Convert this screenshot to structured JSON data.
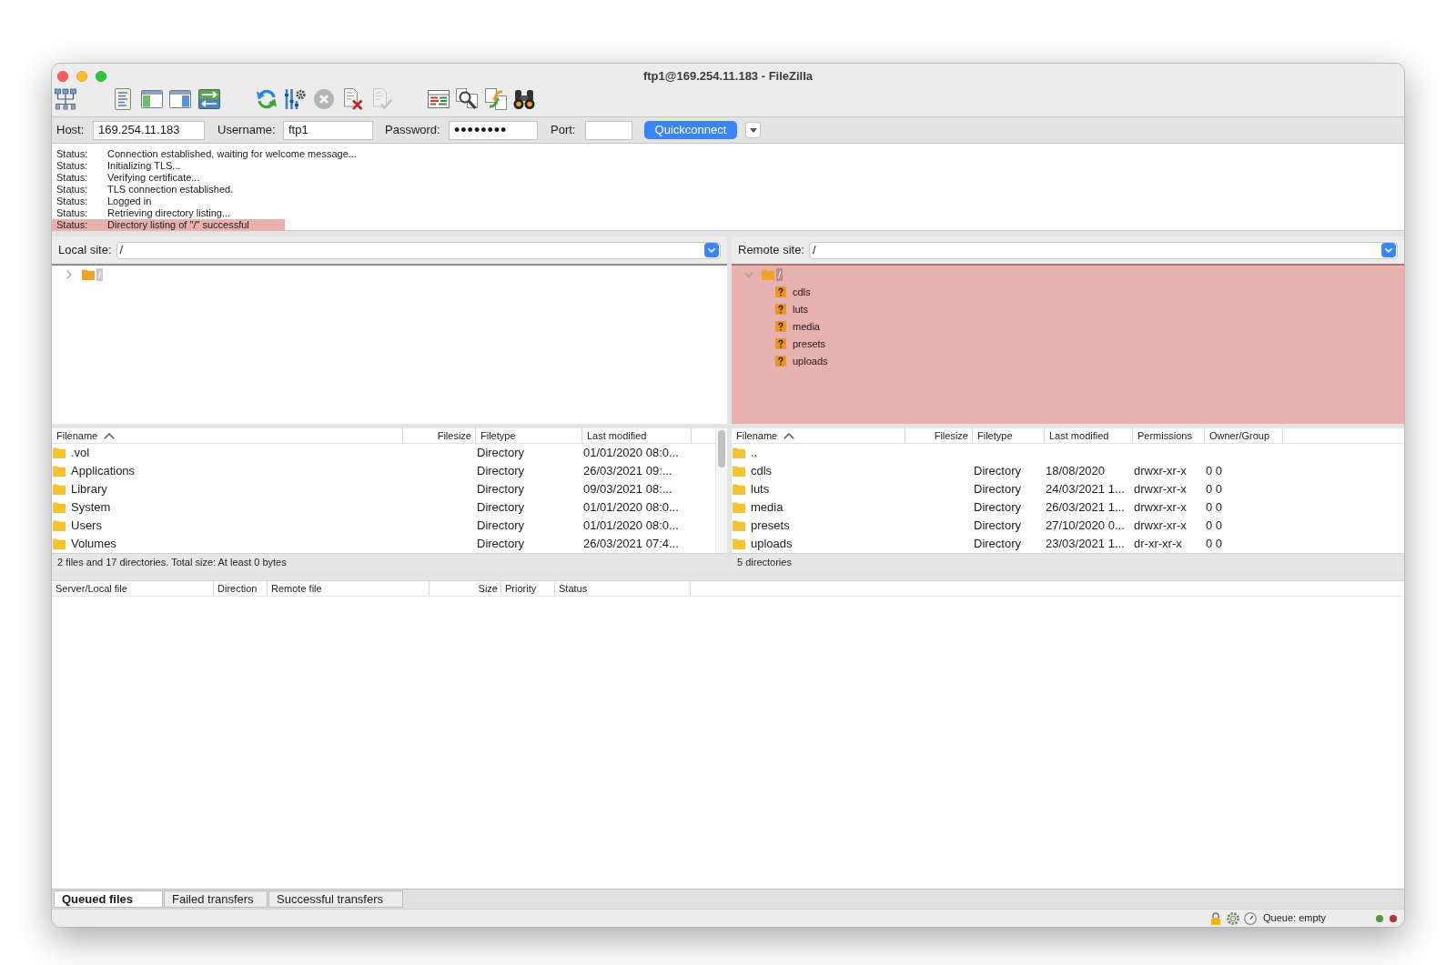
{
  "window": {
    "title": "ftp1@169.254.11.183 - FileZilla"
  },
  "toolbar": [
    [
      {
        "kind": "site-manager",
        "disabled": false
      }
    ],
    [
      {
        "kind": "message-log",
        "disabled": false
      },
      {
        "kind": "local-tree",
        "disabled": false
      },
      {
        "kind": "remote-tree",
        "disabled": false
      },
      {
        "kind": "transfer-queue",
        "disabled": false
      }
    ],
    [
      {
        "kind": "refresh",
        "disabled": false
      },
      {
        "kind": "process-queue",
        "disabled": false
      },
      {
        "kind": "cancel",
        "disabled": true
      },
      {
        "kind": "disconnect",
        "disabled": false
      },
      {
        "kind": "reconnect",
        "disabled": true
      }
    ],
    [
      {
        "kind": "filters",
        "disabled": false
      },
      {
        "kind": "compare",
        "disabled": false
      },
      {
        "kind": "sync-browsing",
        "disabled": false
      },
      {
        "kind": "search",
        "disabled": false
      }
    ]
  ],
  "quickconnect": {
    "fields": [
      {
        "kind": "text",
        "label": "Host:",
        "value": "169.254.11.183"
      },
      {
        "kind": "text",
        "label": "Username:",
        "value": "ftp1"
      },
      {
        "kind": "password",
        "label": "Password:",
        "value": "••••••••"
      },
      {
        "kind": "text",
        "label": "Port:"
      }
    ],
    "button": "Quickconnect"
  },
  "message_log": [
    {
      "type": "Status:",
      "text": "Connection established, waiting for welcome message...",
      "highlighted": false
    },
    {
      "type": "Status:",
      "text": "Initializing TLS...",
      "highlighted": false
    },
    {
      "type": "Status:",
      "text": "Verifying certificate...",
      "highlighted": false
    },
    {
      "type": "Status:",
      "text": "TLS connection established.",
      "highlighted": false
    },
    {
      "type": "Status:",
      "text": "Logged in",
      "highlighted": false
    },
    {
      "type": "Status:",
      "text": "Retrieving directory listing...",
      "highlighted": false
    },
    {
      "type": "Status:",
      "text": "Directory listing of \"/\" successful",
      "highlighted": true
    }
  ],
  "local_site": {
    "label": "Local site:",
    "path": "/",
    "highlighted": false,
    "tree": [
      {
        "name": "/",
        "expanded": false,
        "selected": true
      }
    ]
  },
  "remote_site": {
    "label": "Remote site:",
    "path": "/",
    "highlighted": true,
    "tree": [
      {
        "name": "/",
        "expanded": true,
        "selected": true,
        "children": [
          {
            "name": "cdls",
            "selected": false
          },
          {
            "name": "luts",
            "selected": false
          },
          {
            "name": "media",
            "selected": false
          },
          {
            "name": "presets",
            "selected": false
          },
          {
            "name": "uploads",
            "selected": false
          }
        ]
      }
    ]
  },
  "local_files": {
    "columns": [
      {
        "label": "Filename",
        "sorted": true
      },
      {
        "label": "Filesize",
        "sorted": false
      },
      {
        "label": "Filetype",
        "sorted": false
      },
      {
        "label": "Last modified",
        "sorted": false
      }
    ],
    "rows": [
      {
        "filename": ".vol",
        "filetype": "Directory",
        "last_modified": "01/01/2020 08:0..."
      },
      {
        "filename": "Applications",
        "filetype": "Directory",
        "last_modified": "26/03/2021 09:..."
      },
      {
        "filename": "Library",
        "filetype": "Directory",
        "last_modified": "09/03/2021 08:..."
      },
      {
        "filename": "System",
        "filetype": "Directory",
        "last_modified": "01/01/2020 08:0..."
      },
      {
        "filename": "Users",
        "filetype": "Directory",
        "last_modified": "01/01/2020 08:0..."
      },
      {
        "filename": "Volumes",
        "filetype": "Directory",
        "last_modified": "26/03/2021 07:4..."
      }
    ],
    "summary": "2 files and 17 directories. Total size: At least 0 bytes"
  },
  "remote_files": {
    "columns": [
      {
        "label": "Filename",
        "sorted": true
      },
      {
        "label": "Filesize",
        "sorted": false
      },
      {
        "label": "Filetype",
        "sorted": false
      },
      {
        "label": "Last modified",
        "sorted": false
      },
      {
        "label": "Permissions",
        "sorted": false
      },
      {
        "label": "Owner/Group",
        "sorted": false
      }
    ],
    "rows": [
      {
        "filename": ".."
      },
      {
        "filename": "cdls",
        "filetype": "Directory",
        "last_modified": "18/08/2020",
        "permissions": "drwxr-xr-x",
        "owner_group": "0 0"
      },
      {
        "filename": "luts",
        "filetype": "Directory",
        "last_modified": "24/03/2021 1...",
        "permissions": "drwxr-xr-x",
        "owner_group": "0 0"
      },
      {
        "filename": "media",
        "filetype": "Directory",
        "last_modified": "26/03/2021 1...",
        "permissions": "drwxr-xr-x",
        "owner_group": "0 0"
      },
      {
        "filename": "presets",
        "filetype": "Directory",
        "last_modified": "27/10/2020 0...",
        "permissions": "drwxr-xr-x",
        "owner_group": "0 0"
      },
      {
        "filename": "uploads",
        "filetype": "Directory",
        "last_modified": "23/03/2021 1...",
        "permissions": "dr-xr-xr-x",
        "owner_group": "0 0"
      }
    ],
    "summary": "5 directories"
  },
  "queue": {
    "columns": [
      "Server/Local file",
      "Direction",
      "Remote file",
      "Size",
      "Priority",
      "Status"
    ],
    "tabs": [
      {
        "label": "Queued files",
        "selected": true
      },
      {
        "label": "Failed transfers",
        "selected": false
      },
      {
        "label": "Successful transfers",
        "selected": false
      }
    ]
  },
  "status_bar": {
    "queue": "Queue: empty",
    "lights": [
      {
        "color": "#4f9a3c"
      },
      {
        "color": "#b3352c"
      }
    ]
  }
}
